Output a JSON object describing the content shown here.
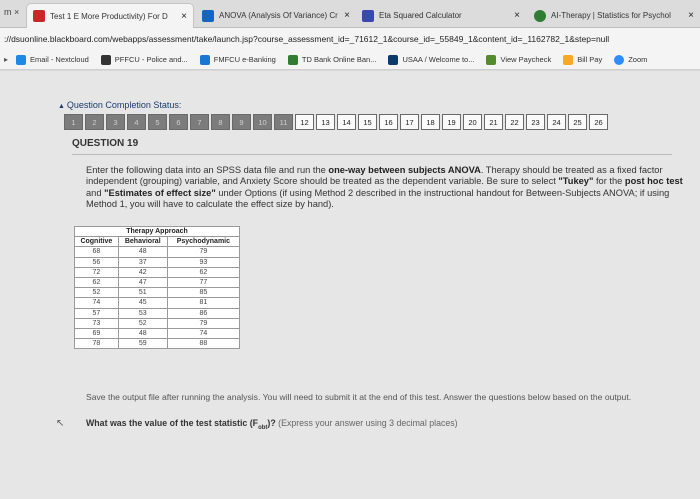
{
  "browser": {
    "strip_lead": "m  ×",
    "tabs": [
      {
        "label": "Test 1 E More Productivity) For D",
        "icon_color": "#c62828"
      },
      {
        "label": "ANOVA (Analysis Of Variance) Cr",
        "icon_color": "#1565c0"
      },
      {
        "label": "Eta Squared Calculator",
        "icon_color": "#3949ab"
      },
      {
        "label": "AI-Therapy | Statistics for Psychol",
        "icon_color": "#2e7d32"
      }
    ],
    "close_glyph": "×",
    "url": "://dsuonline.blackboard.com/webapps/assessment/take/launch.jsp?course_assessment_id=_71612_1&course_id=_55849_1&content_id=_1162782_1&step=null",
    "bookmarks": [
      {
        "label": "Email - Nextcloud",
        "icon_color": "#1e88e5"
      },
      {
        "label": "PFFCU - Police and...",
        "icon_color": "#333333"
      },
      {
        "label": "FMFCU e-Banking",
        "icon_color": "#1976d2"
      },
      {
        "label": "TD Bank Online Ban...",
        "icon_color": "#2e7d32"
      },
      {
        "label": "USAA / Welcome to...",
        "icon_color": "#0d3b66"
      },
      {
        "label": "View Paycheck",
        "icon_color": "#558b2f"
      },
      {
        "label": "Bill Pay",
        "icon_color": "#f9a825"
      },
      {
        "label": "Zoom",
        "icon_color": "#2d8cff"
      }
    ]
  },
  "page": {
    "status_label": "Question Completion Status:",
    "question_numbers": [
      "1",
      "2",
      "3",
      "4",
      "5",
      "6",
      "7",
      "8",
      "9",
      "10",
      "11",
      "12",
      "13",
      "14",
      "15",
      "16",
      "17",
      "18",
      "19",
      "20",
      "21",
      "22",
      "23",
      "24",
      "25",
      "26"
    ],
    "completed_count": 11,
    "question_header": "QUESTION 19",
    "prompt": {
      "p1": "Enter the following data into an SPSS data file and run the ",
      "b1": "one-way between subjects ANOVA",
      "p2": ". Therapy should be treated as a fixed factor independent (grouping) variable, and Anxiety Score should be treated as the dependent variable. Be sure to select ",
      "b2": "\"Tukey\"",
      "p3": " for the ",
      "b3": "post hoc test",
      "p4": " and ",
      "b4": "\"Estimates of effect size\"",
      "p5": " under Options (if using Method 2 described in the instructional handout for Between-Subjects ANOVA; if using Method 1, you will have to calculate the effect size by hand)."
    },
    "table": {
      "caption": "Therapy Approach",
      "headers": [
        "Cognitive",
        "Behavioral",
        "Psychodynamic"
      ],
      "rows": [
        [
          "68",
          "48",
          "79"
        ],
        [
          "56",
          "37",
          "93"
        ],
        [
          "72",
          "42",
          "62"
        ],
        [
          "62",
          "47",
          "77"
        ],
        [
          "52",
          "51",
          "85"
        ],
        [
          "74",
          "45",
          "81"
        ],
        [
          "57",
          "53",
          "86"
        ],
        [
          "73",
          "52",
          "79"
        ],
        [
          "69",
          "48",
          "74"
        ],
        [
          "78",
          "59",
          "88"
        ]
      ]
    },
    "save_text": "Save the output file after running the analysis. You will need to submit it at the end of this test. Answer the questions below based on the output.",
    "question_bold": "What was the value of the test statistic (F",
    "question_sub": "obt",
    "question_bold_end": ")?",
    "question_hint": " (Express your answer using 3 decimal places)"
  }
}
